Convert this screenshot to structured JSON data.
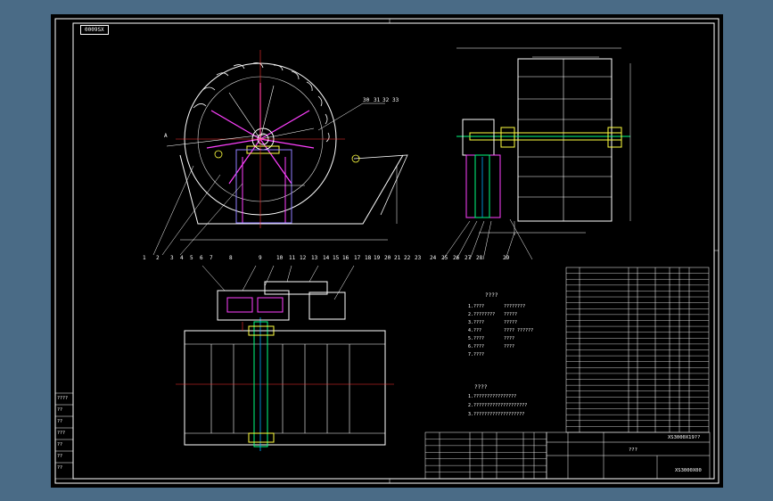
{
  "drawing": {
    "frame_tag": "0009SX",
    "view_labels": {
      "section": "A"
    },
    "part_numbers_front": [
      "1",
      "2",
      "3",
      "4",
      "5",
      "6",
      "7",
      "8"
    ],
    "part_numbers_side": [
      "24",
      "25",
      "26",
      "27",
      "28",
      "29"
    ],
    "part_numbers_top": [
      "9",
      "10",
      "11",
      "12",
      "13",
      "14",
      "15",
      "16",
      "17",
      "18",
      "19",
      "20",
      "21",
      "22",
      "23"
    ],
    "balloon_top_right": [
      "30",
      "31",
      "32",
      "33"
    ],
    "notes_title": "????",
    "notes_lines": [
      "1.????",
      "2.????????",
      "3.????",
      "4.???",
      "5.????",
      "6.????",
      "7.????"
    ],
    "notes_right": [
      "????????",
      "?????",
      "?????",
      "???? ??????",
      "????",
      "????"
    ],
    "tech_req_title": "????",
    "tech_req_lines": [
      "1.????????????????",
      "2.????????????????????",
      "3.???????????????????"
    ],
    "title_block": {
      "title": "???",
      "drawing_no": "XS3000X19??",
      "sub_no": "XS3000X00"
    },
    "left_revision_rows": [
      "????",
      "??",
      "??",
      "???",
      "??",
      "??",
      "??"
    ]
  }
}
